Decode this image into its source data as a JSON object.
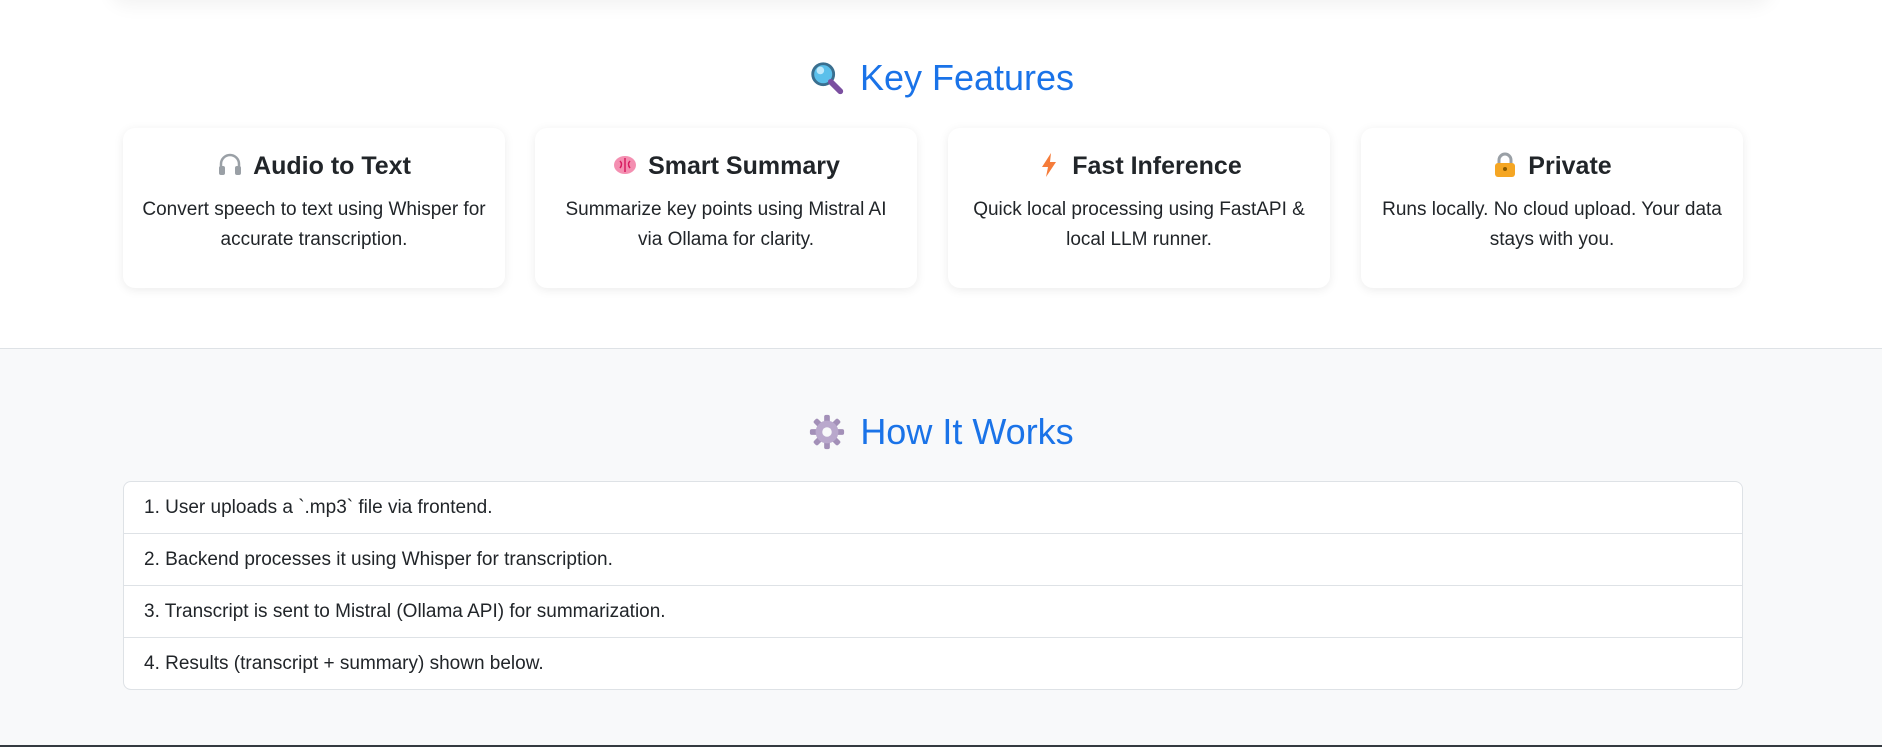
{
  "features": {
    "title": "Key Features",
    "title_icon": "magnifying-glass-icon",
    "cards": [
      {
        "icon": "headphones-icon",
        "title": "Audio to Text",
        "text": "Convert speech to text using Whisper for accurate transcription."
      },
      {
        "icon": "brain-icon",
        "title": "Smart Summary",
        "text": "Summarize key points using Mistral AI via Ollama for clarity."
      },
      {
        "icon": "lightning-icon",
        "title": "Fast Inference",
        "text": "Quick local processing using FastAPI & local LLM runner."
      },
      {
        "icon": "lock-icon",
        "title": "Private",
        "text": "Runs locally. No cloud upload. Your data stays with you."
      }
    ]
  },
  "how_it_works": {
    "title": "How It Works",
    "title_icon": "gear-icon",
    "steps": [
      "1. User uploads a `.mp3` file via frontend.",
      "2. Backend processes it using Whisper for transcription.",
      "3. Transcript is sent to Mistral (Ollama API) for summarization.",
      "4. Results (transcript + summary) shown below."
    ]
  },
  "colors": {
    "accent": "#1a73e8",
    "text": "#212529",
    "section_bg": "#f8f9fa",
    "border": "#dee2e6"
  }
}
